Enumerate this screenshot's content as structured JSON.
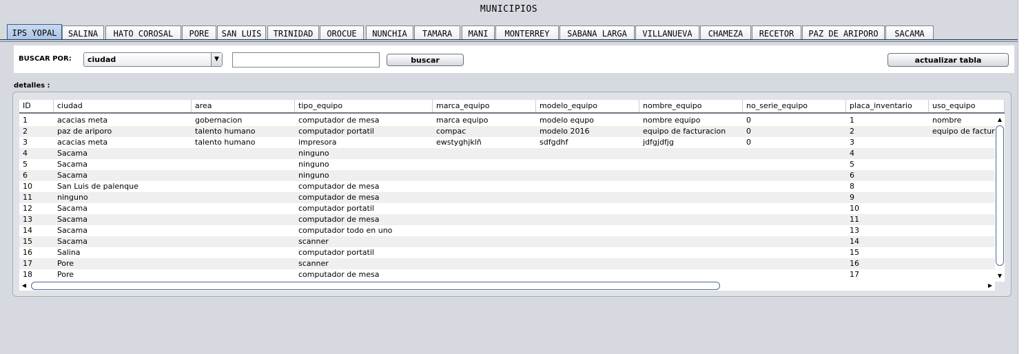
{
  "window": {
    "title": "MUNICIPIOS"
  },
  "tabs": [
    {
      "label": "IPS YOPAL",
      "active": true
    },
    {
      "label": "SALINA"
    },
    {
      "label": "HATO COROSAL"
    },
    {
      "label": "PORE"
    },
    {
      "label": "SAN LUIS"
    },
    {
      "label": "TRINIDAD"
    },
    {
      "label": "OROCUE"
    },
    {
      "label": "NUNCHIA"
    },
    {
      "label": "TAMARA"
    },
    {
      "label": "MANI"
    },
    {
      "label": "MONTERREY"
    },
    {
      "label": "SABANA LARGA"
    },
    {
      "label": "VILLANUEVA"
    },
    {
      "label": "CHAMEZA"
    },
    {
      "label": "RECETOR"
    },
    {
      "label": "PAZ DE ARIPORO"
    },
    {
      "label": "SACAMA"
    }
  ],
  "search": {
    "label": "BUSCAR POR:",
    "selected": "ciudad",
    "input_value": "",
    "search_button": "buscar",
    "refresh_button": "actualizar tabla"
  },
  "details_label": "detalles :",
  "table": {
    "columns": [
      "ID",
      "ciudad",
      "area",
      "tipo_equipo",
      "marca_equipo",
      "modelo_equipo",
      "nombre_equipo",
      "no_serie_equipo",
      "placa_inventario",
      "uso_equipo"
    ],
    "rows": [
      [
        "1",
        "acacias meta",
        "gobernacion",
        "computador de mesa",
        "marca equipo",
        "modelo equpo",
        "nombre equipo",
        "0",
        "1",
        "nombre"
      ],
      [
        "2",
        "paz de ariporo",
        "talento humano",
        "computador portatil",
        "compac",
        "modelo 2016",
        "equipo de facturacion",
        "0",
        "2",
        "equipo de factura"
      ],
      [
        "3",
        "acacias meta",
        "talento humano",
        "impresora",
        "ewstyghjklñ",
        "sdfgdhf",
        "jdfgjdfjg",
        "0",
        "3",
        ""
      ],
      [
        "4",
        "Sacama",
        "",
        "ninguno",
        "",
        "",
        "",
        "",
        "4",
        ""
      ],
      [
        "5",
        "Sacama",
        "",
        "ninguno",
        "",
        "",
        "",
        "",
        "5",
        ""
      ],
      [
        "6",
        "Sacama",
        "",
        "ninguno",
        "",
        "",
        "",
        "",
        "6",
        ""
      ],
      [
        "10",
        "San Luis de palenque",
        "",
        "computador de mesa",
        "",
        "",
        "",
        "",
        "8",
        ""
      ],
      [
        "11",
        "ninguno",
        "",
        "computador de mesa",
        "",
        "",
        "",
        "",
        "9",
        ""
      ],
      [
        "12",
        "Sacama",
        "",
        "computador portatil",
        "",
        "",
        "",
        "",
        "10",
        ""
      ],
      [
        "13",
        "Sacama",
        "",
        "computador de mesa",
        "",
        "",
        "",
        "",
        "11",
        ""
      ],
      [
        "14",
        "Sacama",
        "",
        "computador todo en uno",
        "",
        "",
        "",
        "",
        "13",
        ""
      ],
      [
        "15",
        "Sacama",
        "",
        "scanner",
        "",
        "",
        "",
        "",
        "14",
        ""
      ],
      [
        "16",
        "Salina",
        "",
        "computador portatil",
        "",
        "",
        "",
        "",
        "15",
        ""
      ],
      [
        "17",
        "Pore",
        "",
        "scanner",
        "",
        "",
        "",
        "",
        "16",
        ""
      ],
      [
        "18",
        "Pore",
        "",
        "computador de mesa",
        "",
        "",
        "",
        "",
        "17",
        ""
      ]
    ]
  },
  "icons": {
    "combo_arrow": "chevron-down-icon",
    "scroll_up": "arrow-up-icon",
    "scroll_down": "arrow-down-icon",
    "scroll_left": "arrow-left-icon",
    "scroll_right": "arrow-right-icon"
  }
}
